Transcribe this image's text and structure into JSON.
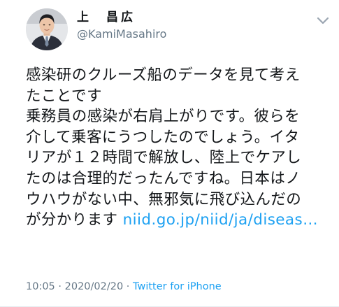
{
  "user": {
    "display_name": "上　昌広",
    "handle": "@KamiMasahiro"
  },
  "tweet": {
    "lines": [
      "感染研のクルーズ船のデータを見て考え",
      "たことです",
      "乗務員の感染が右肩上がりです。彼らを",
      "介して乗客にうつしたのでしょう。イタ",
      "リアが１２時間で解放し、陸上でケアし",
      "たのは合理的だったんですね。日本はノ",
      "ウハウがない中、無邪気に飛び込んだの"
    ],
    "last_line_text": "が分かります ",
    "link_text": "niid.go.jp/niid/ja/diseas…"
  },
  "meta": {
    "time": "10:05",
    "separator": " · ",
    "date": "2020/02/20",
    "separator2": " · ",
    "source": "Twitter for iPhone"
  },
  "icons": {
    "menu": "chevron-down-icon",
    "avatar": "avatar"
  }
}
